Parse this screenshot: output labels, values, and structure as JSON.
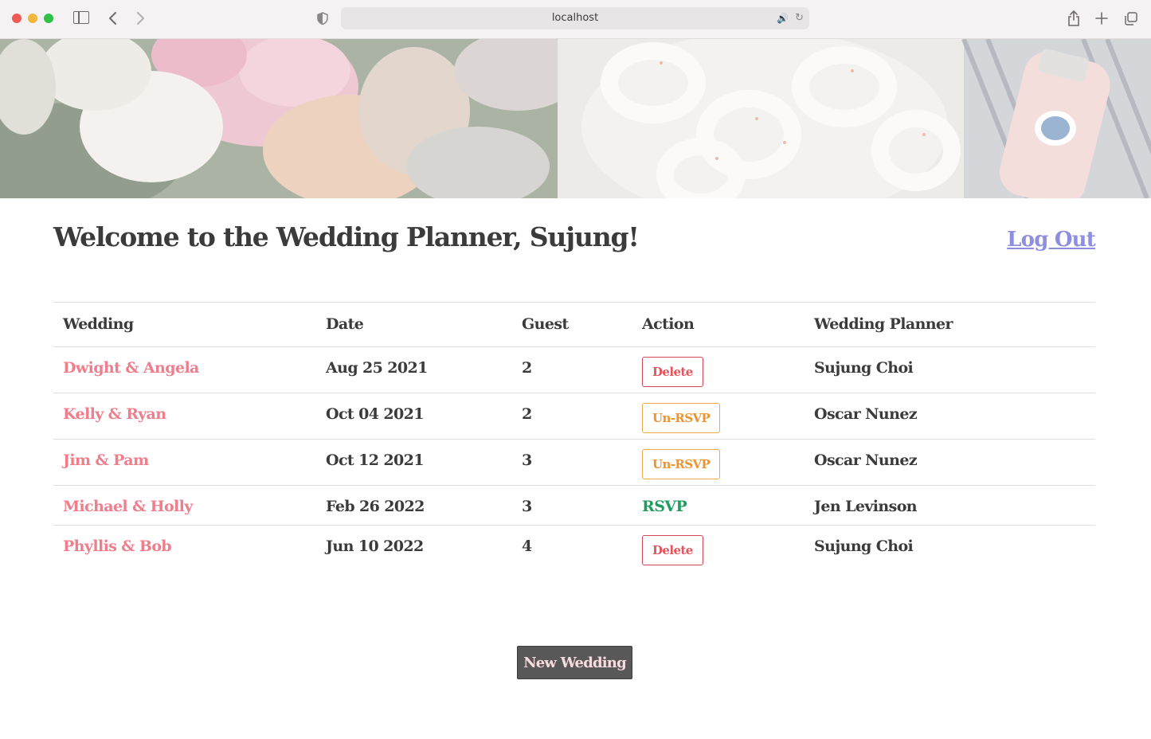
{
  "browser": {
    "url": "localhost"
  },
  "header": {
    "title": "Welcome to the Wedding Planner, Sujung!",
    "logout_label": "Log Out"
  },
  "table": {
    "columns": [
      "Wedding",
      "Date",
      "Guest",
      "Action",
      "Wedding Planner"
    ],
    "rows": [
      {
        "wedding": "Dwight & Angela",
        "date": "Aug 25 2021",
        "guests": "2",
        "action": "Delete",
        "action_type": "delete",
        "planner": "Sujung Choi"
      },
      {
        "wedding": "Kelly & Ryan",
        "date": "Oct 04 2021",
        "guests": "2",
        "action": "Un-RSVP",
        "action_type": "unrsvp",
        "planner": "Oscar Nunez"
      },
      {
        "wedding": "Jim & Pam",
        "date": "Oct 12 2021",
        "guests": "3",
        "action": "Un-RSVP",
        "action_type": "unrsvp",
        "planner": "Oscar Nunez"
      },
      {
        "wedding": "Michael & Holly",
        "date": "Feb 26 2022",
        "guests": "3",
        "action": "RSVP",
        "action_type": "rsvp",
        "planner": "Jen Levinson"
      },
      {
        "wedding": "Phyllis & Bob",
        "date": "Jun 10 2022",
        "guests": "4",
        "action": "Delete",
        "action_type": "delete",
        "planner": "Sujung Choi"
      }
    ]
  },
  "footer": {
    "new_wedding_label": "New Wedding"
  },
  "colors": {
    "wedding_link": "#ef7d8c",
    "logout_link": "#8e8ee0",
    "delete_border": "#d24852",
    "unrsvp_border": "#f0aa4c",
    "rsvp_link": "#1e9d5f",
    "button_bg": "#595858",
    "text": "#3b3b3b"
  },
  "icons": {
    "sidebar": "sidebar-icon",
    "back": "chevron-left-icon",
    "forward": "chevron-right-icon",
    "privacy": "shield-icon",
    "audio": "speaker-icon",
    "reload": "reload-icon",
    "share": "share-icon",
    "new_tab": "plus-icon",
    "tabs": "tabs-icon"
  }
}
